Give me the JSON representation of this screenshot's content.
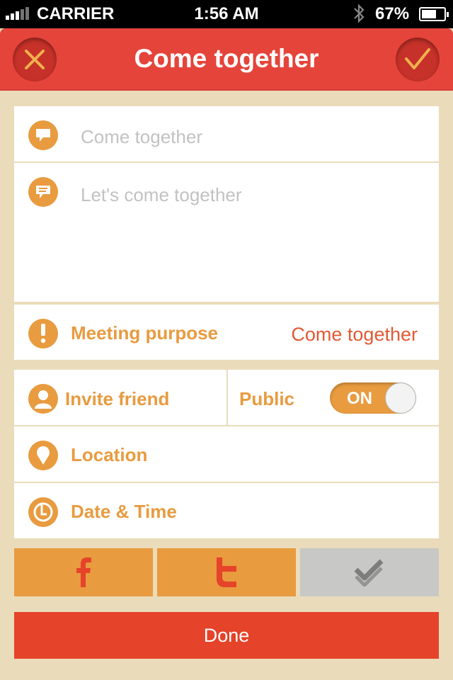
{
  "status_bar": {
    "carrier": "CARRIER",
    "time": "1:56 AM",
    "battery": "67%",
    "battery_level": 0.67
  },
  "nav": {
    "title": "Come together",
    "cancel_icon": "close-icon",
    "confirm_icon": "checkmark-icon"
  },
  "form": {
    "title_placeholder": "Come together",
    "description_placeholder": "Let's come together",
    "purpose_label": "Meeting purpose",
    "purpose_value": "Come together",
    "invite_label": "Invite friend",
    "public_label": "Public",
    "public_toggle": "ON",
    "location_label": "Location",
    "datetime_label": "Date & Time"
  },
  "share": {
    "facebook_icon": "facebook-icon",
    "twitter_icon": "twitter-icon",
    "foursquare_icon": "foursquare-icon"
  },
  "done_label": "Done",
  "colors": {
    "accent_red": "#e5443a",
    "accent_orange": "#e89b3f",
    "value_text": "#e05a35",
    "background": "#eadcbb",
    "disabled": "#c8c8c6"
  }
}
